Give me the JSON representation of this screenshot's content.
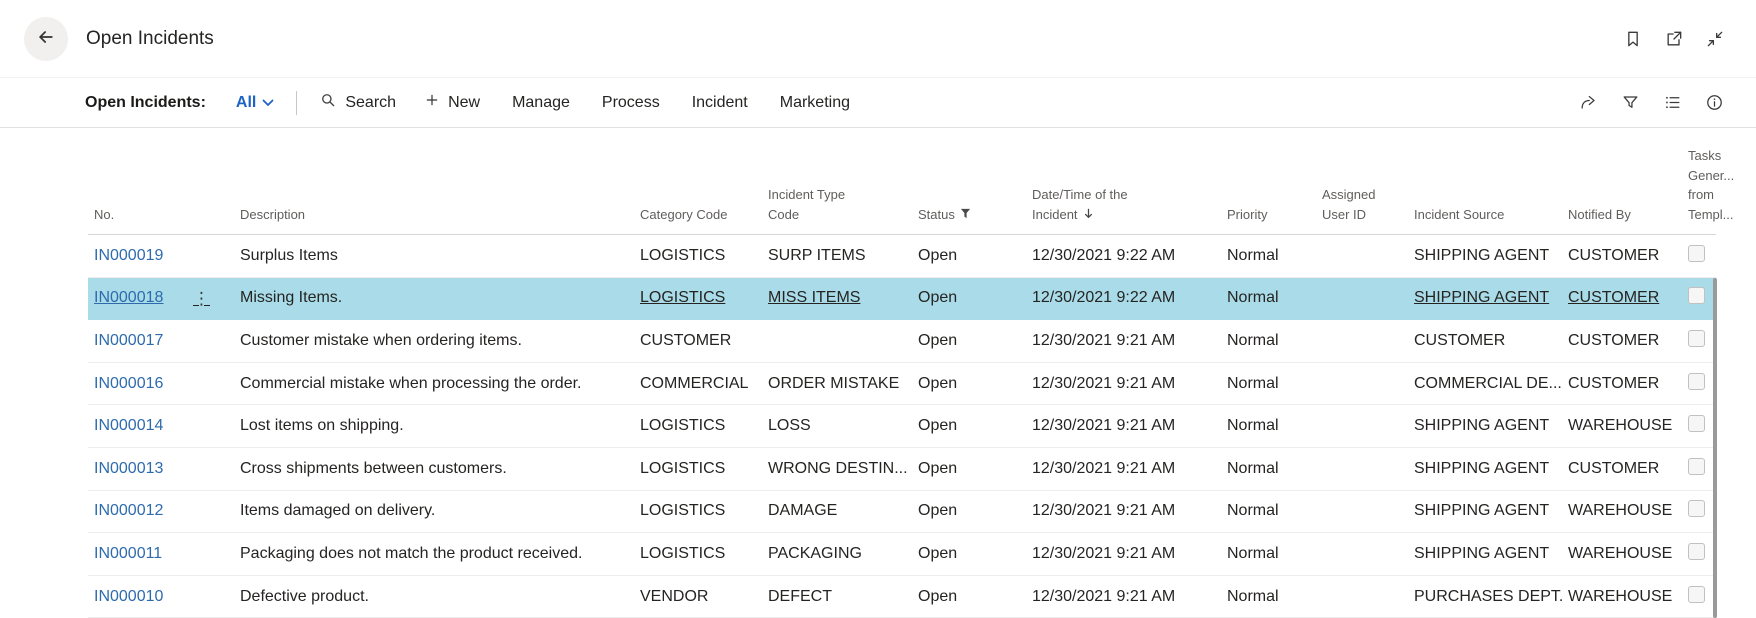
{
  "colors": {
    "link": "#2e6bad",
    "view_filter": "#1f63c4",
    "selected_row_bg": "#a9dce8",
    "header_text": "#605e5c",
    "body_text": "#252423",
    "icon": "#3b3a39"
  },
  "titlebar": {
    "title": "Open Incidents",
    "icons": [
      "arrow-left-icon",
      "bookmark-icon",
      "open-in-new-window-icon",
      "collapse-icon"
    ]
  },
  "toolbar": {
    "caption": "Open Incidents:",
    "view_filter": "All",
    "search_label": "Search",
    "new_label": "New",
    "menu_items": [
      "Manage",
      "Process",
      "Incident",
      "Marketing"
    ],
    "right_icons": [
      "share-icon",
      "filter-icon",
      "show-list-icon",
      "info-icon"
    ]
  },
  "table": {
    "columns": [
      {
        "key": "no",
        "label": "No."
      },
      {
        "key": "description",
        "label": "Description"
      },
      {
        "key": "category_code",
        "label": "Category Code"
      },
      {
        "key": "incident_type_code",
        "label": "Incident Type\nCode"
      },
      {
        "key": "status",
        "label": "Status",
        "header_icon": "filter"
      },
      {
        "key": "datetime",
        "label": "Date/Time of the\nIncident",
        "header_icon": "sort-desc"
      },
      {
        "key": "priority",
        "label": "Priority"
      },
      {
        "key": "assigned_user_id",
        "label": "Assigned\nUser ID"
      },
      {
        "key": "incident_source",
        "label": "Incident Source"
      },
      {
        "key": "notified_by",
        "label": "Notified By"
      },
      {
        "key": "tasks",
        "label": "Tasks\nGener...\nfrom\nTempl...",
        "type": "checkbox"
      }
    ],
    "rows": [
      {
        "no": "IN000019",
        "description": "Surplus Items",
        "category_code": "LOGISTICS",
        "incident_type_code": "SURP ITEMS",
        "status": "Open",
        "datetime": "12/30/2021 9:22 AM",
        "priority": "Normal",
        "assigned_user_id": "",
        "incident_source": "SHIPPING AGENT",
        "notified_by": "CUSTOMER",
        "tasks_checked": false,
        "selected": false
      },
      {
        "no": "IN000018",
        "description": "Missing Items.",
        "category_code": "LOGISTICS",
        "incident_type_code": "MISS ITEMS",
        "status": "Open",
        "datetime": "12/30/2021 9:22 AM",
        "priority": "Normal",
        "assigned_user_id": "",
        "incident_source": "SHIPPING AGENT",
        "notified_by": "CUSTOMER",
        "tasks_checked": false,
        "selected": true
      },
      {
        "no": "IN000017",
        "description": "Customer mistake when ordering items.",
        "category_code": "CUSTOMER",
        "incident_type_code": "",
        "status": "Open",
        "datetime": "12/30/2021 9:21 AM",
        "priority": "Normal",
        "assigned_user_id": "",
        "incident_source": "CUSTOMER",
        "notified_by": "CUSTOMER",
        "tasks_checked": false,
        "selected": false
      },
      {
        "no": "IN000016",
        "description": "Commercial mistake when processing the order.",
        "category_code": "COMMERCIAL",
        "incident_type_code": "ORDER MISTAKE",
        "status": "Open",
        "datetime": "12/30/2021 9:21 AM",
        "priority": "Normal",
        "assigned_user_id": "",
        "incident_source": "COMMERCIAL DE...",
        "notified_by": "CUSTOMER",
        "tasks_checked": false,
        "selected": false
      },
      {
        "no": "IN000014",
        "description": "Lost items on shipping.",
        "category_code": "LOGISTICS",
        "incident_type_code": "LOSS",
        "status": "Open",
        "datetime": "12/30/2021 9:21 AM",
        "priority": "Normal",
        "assigned_user_id": "",
        "incident_source": "SHIPPING AGENT",
        "notified_by": "WAREHOUSE",
        "tasks_checked": false,
        "selected": false
      },
      {
        "no": "IN000013",
        "description": "Cross shipments between customers.",
        "category_code": "LOGISTICS",
        "incident_type_code": "WRONG DESTIN...",
        "status": "Open",
        "datetime": "12/30/2021 9:21 AM",
        "priority": "Normal",
        "assigned_user_id": "",
        "incident_source": "SHIPPING AGENT",
        "notified_by": "CUSTOMER",
        "tasks_checked": false,
        "selected": false
      },
      {
        "no": "IN000012",
        "description": "Items damaged on delivery.",
        "category_code": "LOGISTICS",
        "incident_type_code": "DAMAGE",
        "status": "Open",
        "datetime": "12/30/2021 9:21 AM",
        "priority": "Normal",
        "assigned_user_id": "",
        "incident_source": "SHIPPING AGENT",
        "notified_by": "WAREHOUSE",
        "tasks_checked": false,
        "selected": false
      },
      {
        "no": "IN000011",
        "description": "Packaging does not match the product received.",
        "category_code": "LOGISTICS",
        "incident_type_code": "PACKAGING",
        "status": "Open",
        "datetime": "12/30/2021 9:21 AM",
        "priority": "Normal",
        "assigned_user_id": "",
        "incident_source": "SHIPPING AGENT",
        "notified_by": "WAREHOUSE",
        "tasks_checked": false,
        "selected": false
      },
      {
        "no": "IN000010",
        "description": "Defective product.",
        "category_code": "VENDOR",
        "incident_type_code": "DEFECT",
        "status": "Open",
        "datetime": "12/30/2021 9:21 AM",
        "priority": "Normal",
        "assigned_user_id": "",
        "incident_source": "PURCHASES DEPT.",
        "notified_by": "WAREHOUSE",
        "tasks_checked": false,
        "selected": false
      }
    ]
  }
}
